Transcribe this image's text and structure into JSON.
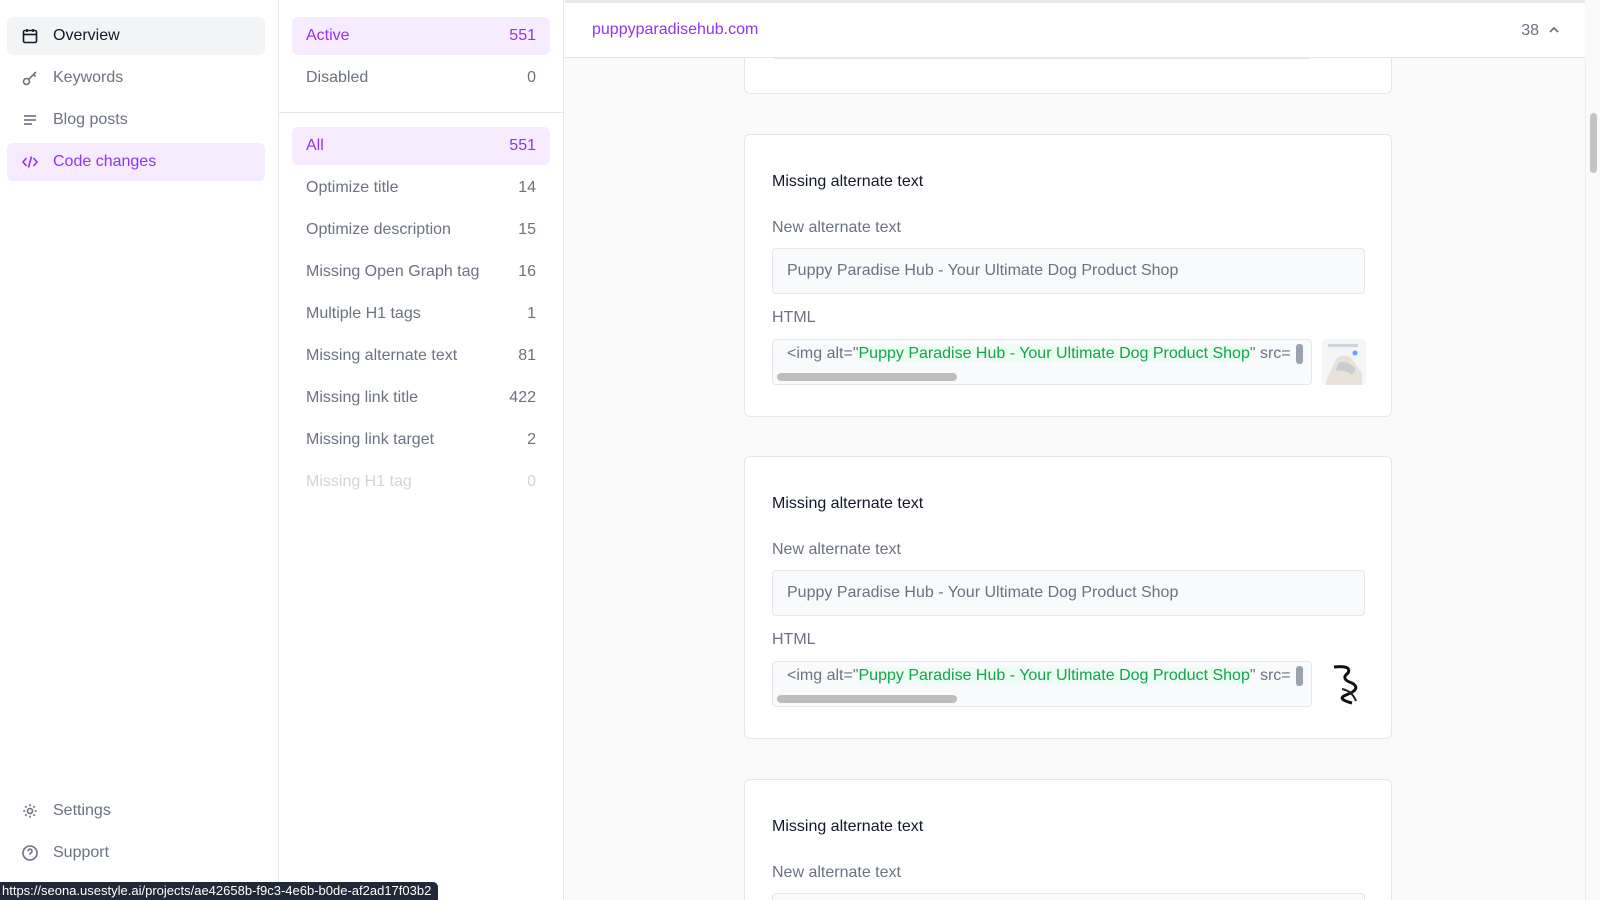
{
  "nav": {
    "items": [
      {
        "label": "Overview",
        "icon": "calendar-icon"
      },
      {
        "label": "Keywords",
        "icon": "key-icon"
      },
      {
        "label": "Blog posts",
        "icon": "lines-icon"
      },
      {
        "label": "Code changes",
        "icon": "code-icon"
      }
    ],
    "bottom": [
      {
        "label": "Settings",
        "icon": "gear-icon"
      },
      {
        "label": "Support",
        "icon": "help-circle-icon"
      }
    ]
  },
  "status_filters": [
    {
      "label": "Active",
      "count": "551"
    },
    {
      "label": "Disabled",
      "count": "0"
    }
  ],
  "type_filters": [
    {
      "label": "All",
      "count": "551"
    },
    {
      "label": "Optimize title",
      "count": "14"
    },
    {
      "label": "Optimize description",
      "count": "15"
    },
    {
      "label": "Missing Open Graph tag",
      "count": "16"
    },
    {
      "label": "Multiple H1 tags",
      "count": "1"
    },
    {
      "label": "Missing alternate text",
      "count": "81"
    },
    {
      "label": "Missing link title",
      "count": "422"
    },
    {
      "label": "Missing link target",
      "count": "2"
    },
    {
      "label": "Missing H1 tag",
      "count": "0"
    }
  ],
  "main": {
    "domain": "puppyparadisehub.com",
    "count": "38",
    "cards": [
      {
        "title": "Missing alternate text",
        "new_alt_label": "New alternate text",
        "new_alt_value": "Puppy Paradise Hub - Your Ultimate Dog Product Shop",
        "html_label": "HTML",
        "html_prefix": "<img alt=\"",
        "html_alt": "Puppy Paradise Hub - Your Ultimate Dog Product Shop",
        "html_suffix": "\" src="
      },
      {
        "title": "Missing alternate text",
        "new_alt_label": "New alternate text",
        "new_alt_value": "Puppy Paradise Hub - Your Ultimate Dog Product Shop",
        "html_label": "HTML",
        "html_prefix": "<img alt=\"",
        "html_alt": "Puppy Paradise Hub - Your Ultimate Dog Product Shop",
        "html_suffix": "\" src="
      },
      {
        "title": "Missing alternate text",
        "new_alt_label": "New alternate text"
      }
    ]
  },
  "status_url": "https://seona.usestyle.ai/projects/ae42658b-f9c3-4e6b-b0de-af2ad17f03b2",
  "colors": {
    "accent": "#9333ea",
    "accent_bg": "#f7ecff",
    "code_green": "#16a34a"
  }
}
